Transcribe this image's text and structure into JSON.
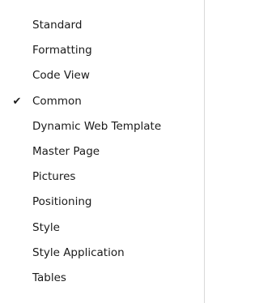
{
  "toolbars_menu": {
    "check_glyph": "✔",
    "items": [
      {
        "label": "Standard",
        "checked": false
      },
      {
        "label": "Formatting",
        "checked": false
      },
      {
        "label": "Code View",
        "checked": false
      },
      {
        "label": "Common",
        "checked": true
      },
      {
        "label": "Dynamic Web Template",
        "checked": false
      },
      {
        "label": "Master Page",
        "checked": false
      },
      {
        "label": "Pictures",
        "checked": false
      },
      {
        "label": "Positioning",
        "checked": false
      },
      {
        "label": "Style",
        "checked": false
      },
      {
        "label": "Style Application",
        "checked": false
      },
      {
        "label": "Tables",
        "checked": false
      }
    ]
  }
}
